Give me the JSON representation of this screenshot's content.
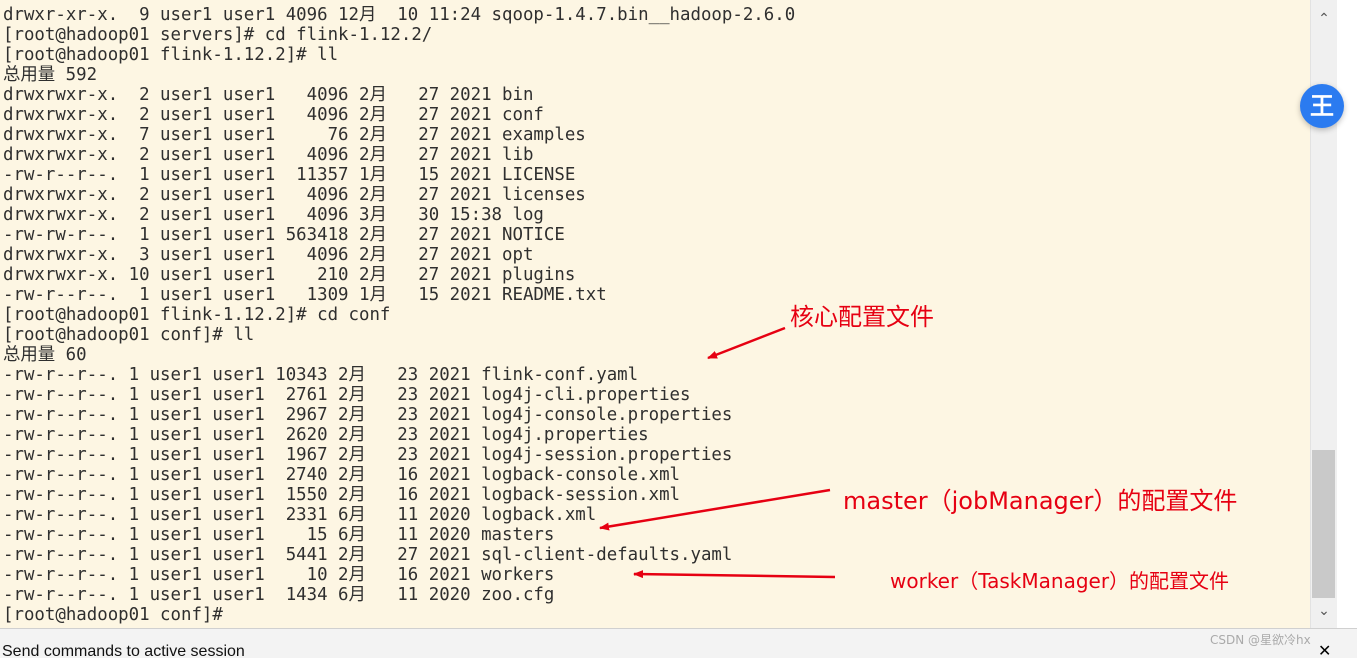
{
  "terminal": {
    "lines": [
      "drwxr-xr-x.  9 user1 user1 4096 12月  10 11:24 sqoop-1.4.7.bin__hadoop-2.6.0",
      "[root@hadoop01 servers]# cd flink-1.12.2/",
      "[root@hadoop01 flink-1.12.2]# ll",
      "总用量 592",
      "drwxrwxr-x.  2 user1 user1   4096 2月   27 2021 bin",
      "drwxrwxr-x.  2 user1 user1   4096 2月   27 2021 conf",
      "drwxrwxr-x.  7 user1 user1     76 2月   27 2021 examples",
      "drwxrwxr-x.  2 user1 user1   4096 2月   27 2021 lib",
      "-rw-r--r--.  1 user1 user1  11357 1月   15 2021 LICENSE",
      "drwxrwxr-x.  2 user1 user1   4096 2月   27 2021 licenses",
      "drwxrwxr-x.  2 user1 user1   4096 3月   30 15:38 log",
      "-rw-rw-r--.  1 user1 user1 563418 2月   27 2021 NOTICE",
      "drwxrwxr-x.  3 user1 user1   4096 2月   27 2021 opt",
      "drwxrwxr-x. 10 user1 user1    210 2月   27 2021 plugins",
      "-rw-r--r--.  1 user1 user1   1309 1月   15 2021 README.txt",
      "[root@hadoop01 flink-1.12.2]# cd conf",
      "[root@hadoop01 conf]# ll",
      "总用量 60",
      "-rw-r--r--. 1 user1 user1 10343 2月   23 2021 flink-conf.yaml",
      "-rw-r--r--. 1 user1 user1  2761 2月   23 2021 log4j-cli.properties",
      "-rw-r--r--. 1 user1 user1  2967 2月   23 2021 log4j-console.properties",
      "-rw-r--r--. 1 user1 user1  2620 2月   23 2021 log4j.properties",
      "-rw-r--r--. 1 user1 user1  1967 2月   23 2021 log4j-session.properties",
      "-rw-r--r--. 1 user1 user1  2740 2月   16 2021 logback-console.xml",
      "-rw-r--r--. 1 user1 user1  1550 2月   16 2021 logback-session.xml",
      "-rw-r--r--. 1 user1 user1  2331 6月   11 2020 logback.xml",
      "-rw-r--r--. 1 user1 user1    15 6月   11 2020 masters",
      "-rw-r--r--. 1 user1 user1  5441 2月   27 2021 sql-client-defaults.yaml",
      "-rw-r--r--. 1 user1 user1    10 2月   16 2021 workers",
      "-rw-r--r--. 1 user1 user1  1434 6月   11 2020 zoo.cfg",
      "[root@hadoop01 conf]#"
    ]
  },
  "annotations": {
    "core_config": "核心配置文件",
    "master_config": "master（jobManager）的配置文件",
    "worker_config": "worker（TaskManager）的配置文件",
    "color": "#e60012"
  },
  "scrollbar": {
    "up_icon": "chevron-up-icon",
    "down_icon": "chevron-down-icon"
  },
  "float_badge": {
    "label": "王",
    "color": "#2b7bf0"
  },
  "status_bar": {
    "text": "Send commands to active session",
    "close_icon": "close-icon"
  },
  "watermark": "CSDN @星欲冷hx",
  "colors": {
    "terminal_bg": "#fdf6e3",
    "terminal_fg": "#2f2f2f"
  }
}
